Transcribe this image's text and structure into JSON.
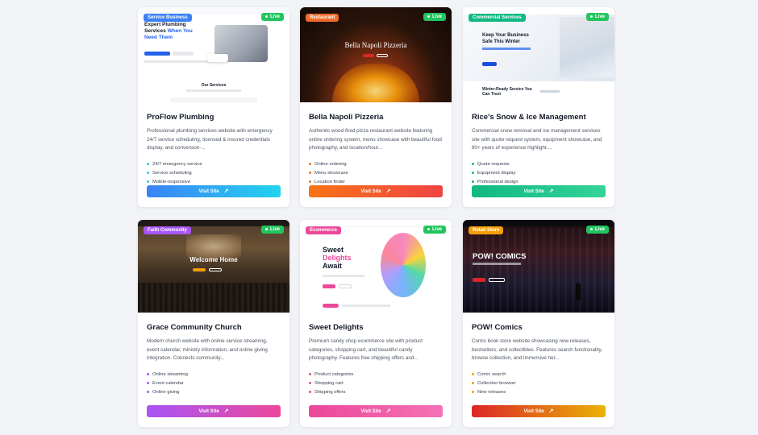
{
  "cards": [
    {
      "category": "Service Business",
      "status": "Live",
      "title": "ProFlow Plumbing",
      "description": "Professional plumbing services website with emergency 24/7 service scheduling, licensed & insured credentials display, and conversion-...",
      "features": [
        "24/7 emergency service",
        "Service scheduling",
        "Mobile-responsive"
      ],
      "button": "Visit Site",
      "colors": {
        "accent": "#2563eb",
        "badge": "#3b82f6",
        "button_from": "#3b82f6",
        "button_to": "#22d3ee",
        "bullet": "#38bdf8"
      },
      "preview": {
        "headline_1": "Expert Plumbing",
        "headline_2": "Services",
        "headline_3": "When You",
        "headline_4": "Need Them",
        "section": "Our Services"
      }
    },
    {
      "category": "Restaurant",
      "status": "Live",
      "title": "Bella Napoli Pizzeria",
      "description": "Authentic wood-fired pizza restaurant website featuring online ordering system, menu showcase with beautiful food photography, and location/hour...",
      "features": [
        "Online ordering",
        "Menu showcase",
        "Location finder"
      ],
      "button": "Visit Site",
      "colors": {
        "badge": "#ef6b2c",
        "button_from": "#f97316",
        "button_to": "#ef4444",
        "bullet": "#f97316"
      },
      "preview": {
        "headline": "Bella Napoli Pizzeria"
      }
    },
    {
      "category": "Commercial Services",
      "status": "Live",
      "title": "Rice's Snow & Ice Management",
      "description": "Commercial snow removal and ice management services site with quote request system, equipment showcase, and 80+ years of experience highlight....",
      "features": [
        "Quote requests",
        "Equipment display",
        "Professional design"
      ],
      "button": "Visit Site",
      "colors": {
        "badge": "#10b981",
        "button_from": "#10b981",
        "button_to": "#34d399",
        "bullet": "#10b981"
      },
      "preview": {
        "headline_1": "Keep Your Business",
        "headline_2": "Safe This Winter",
        "section_1": "Winter-Ready Service You",
        "section_2": "Can Trust"
      }
    },
    {
      "category": "Faith Community",
      "status": "Live",
      "title": "Grace Community Church",
      "description": "Modern church website with online service streaming, event calendar, ministry information, and online giving integration. Connects community...",
      "features": [
        "Online streaming",
        "Event calendar",
        "Online giving"
      ],
      "button": "Visit Site",
      "colors": {
        "badge": "#a855f7",
        "button_from": "#a855f7",
        "button_to": "#ec4899",
        "bullet": "#a855f7"
      },
      "preview": {
        "headline": "Welcome Home"
      }
    },
    {
      "category": "Ecommerce",
      "status": "Live",
      "title": "Sweet Delights",
      "description": "Premium candy shop ecommerce site with product categories, shopping cart, and beautiful candy photography. Features free shipping offers and...",
      "features": [
        "Product categories",
        "Shopping cart",
        "Shipping offers"
      ],
      "button": "Visit Site",
      "colors": {
        "badge": "#ec4899",
        "button_from": "#ec4899",
        "button_to": "#f472b6",
        "bullet": "#ec4899"
      },
      "preview": {
        "headline_1": "Sweet",
        "headline_2": "Delights",
        "headline_3": "Await"
      }
    },
    {
      "category": "Retail Store",
      "status": "Live",
      "title": "POW! Comics",
      "description": "Comic book store website showcasing new releases, bestsellers, and collectibles. Features search functionality, browse collection, and immersive her...",
      "features": [
        "Comic search",
        "Collection browser",
        "New releases"
      ],
      "button": "Visit Site",
      "colors": {
        "badge": "#f59e0b",
        "button_from": "#dc2626",
        "button_to": "#eab308",
        "bullet": "#f59e0b"
      },
      "preview": {
        "headline": "POW! COMICS"
      }
    }
  ]
}
